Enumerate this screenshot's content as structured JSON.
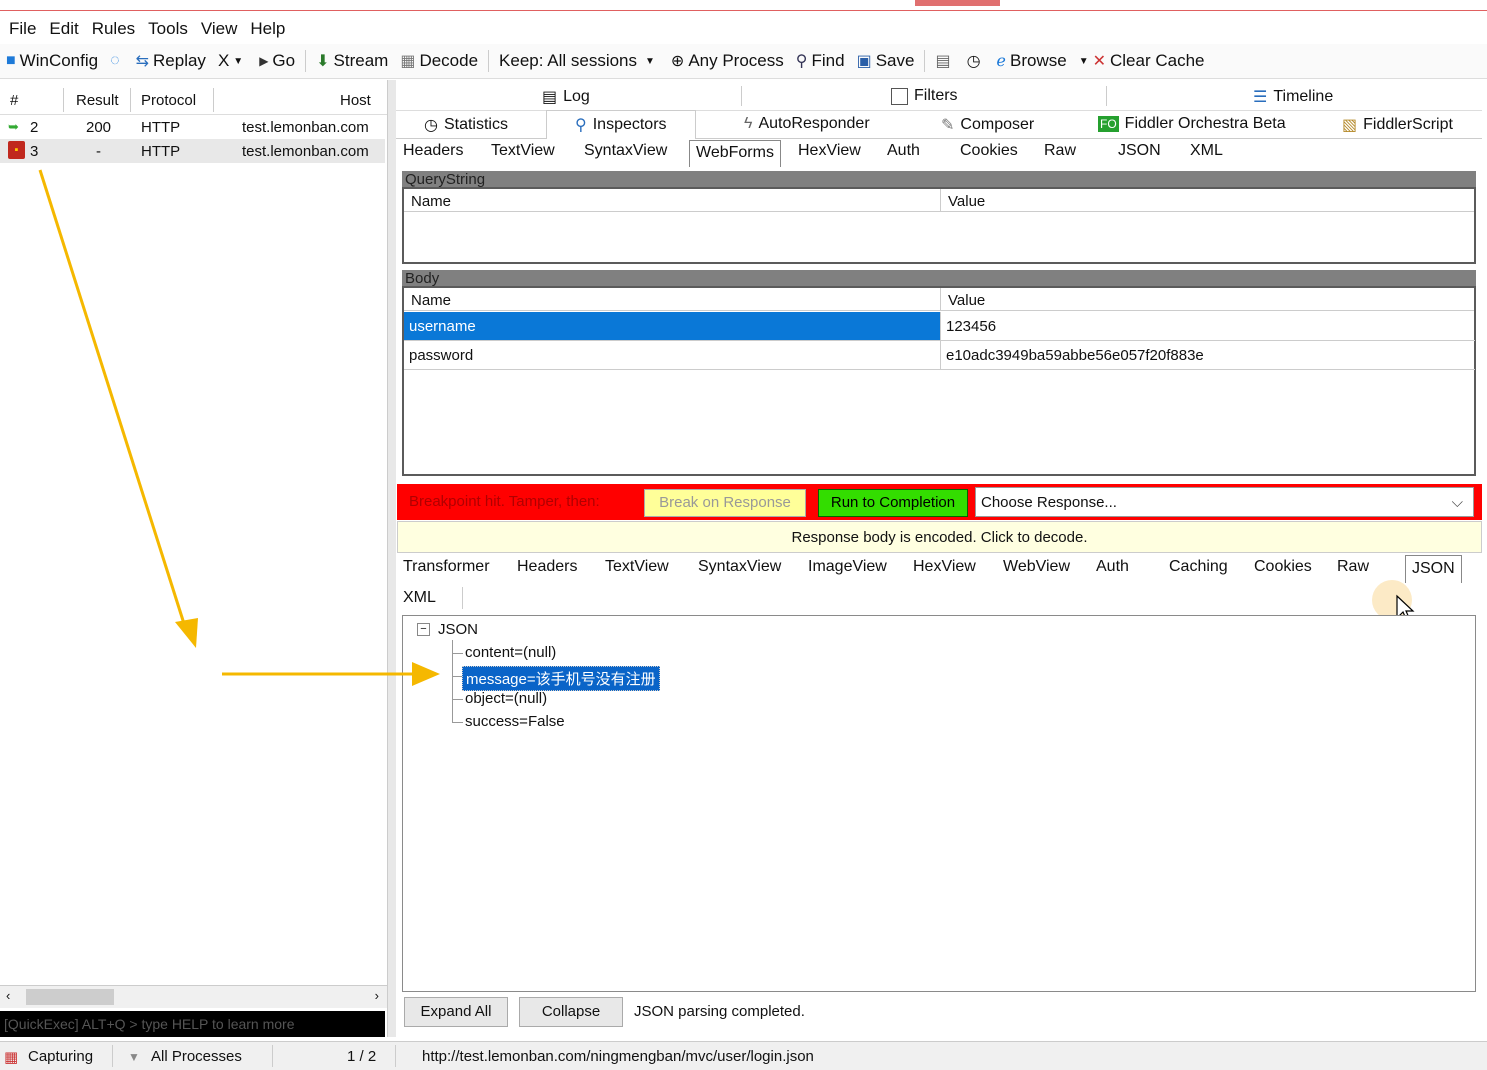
{
  "menu": [
    "File",
    "Edit",
    "Rules",
    "Tools",
    "View",
    "Help"
  ],
  "toolbar": {
    "winconfig": "WinConfig",
    "replay": "Replay",
    "remove": "X",
    "go": "Go",
    "stream": "Stream",
    "decode": "Decode",
    "keep": "Keep: All sessions",
    "process": "Any Process",
    "find": "Find",
    "save": "Save",
    "browse": "Browse",
    "clear_cache": "Clear Cache"
  },
  "sessions": {
    "headers": [
      "#",
      "Result",
      "Protocol",
      "Host"
    ],
    "rows": [
      {
        "id": "2",
        "result": "200",
        "protocol": "HTTP",
        "host": "test.lemonban.com"
      },
      {
        "id": "3",
        "result": "-",
        "protocol": "HTTP",
        "host": "test.lemonban.com"
      }
    ],
    "quickexec": "[QuickExec] ALT+Q > type HELP to learn more"
  },
  "top_tabs": {
    "log": "Log",
    "filters": "Filters",
    "timeline": "Timeline",
    "statistics": "Statistics",
    "inspectors": "Inspectors",
    "autoresponder": "AutoResponder",
    "composer": "Composer",
    "orchestra": "Fiddler Orchestra Beta",
    "orchestra_badge": "FO",
    "fiddlerscript": "FiddlerScript"
  },
  "request_tabs": [
    "Headers",
    "TextView",
    "SyntaxView",
    "WebForms",
    "HexView",
    "Auth",
    "Cookies",
    "Raw",
    "JSON",
    "XML"
  ],
  "querystring": {
    "title": "QueryString",
    "col_name": "Name",
    "col_value": "Value"
  },
  "body": {
    "title": "Body",
    "col_name": "Name",
    "col_value": "Value",
    "rows": [
      {
        "name": "username",
        "value": "123456"
      },
      {
        "name": "password",
        "value": "e10adc3949ba59abbe56e057f20f883e"
      }
    ]
  },
  "breakpoint": {
    "text": "Breakpoint hit. Tamper, then:",
    "break_on_response": "Break on Response",
    "run_to_completion": "Run to Completion",
    "choose_response": "Choose Response...",
    "encoded_notice": "Response body is encoded. Click to decode."
  },
  "response_tabs": [
    "Transformer",
    "Headers",
    "TextView",
    "SyntaxView",
    "ImageView",
    "HexView",
    "WebView",
    "Auth",
    "Caching",
    "Cookies",
    "Raw",
    "JSON"
  ],
  "response_tabs_row2": [
    "XML"
  ],
  "json_tree": {
    "root": "JSON",
    "children": [
      "content=(null)",
      "message=该手机号没有注册",
      "object=(null)",
      "success=False"
    ]
  },
  "json_buttons": {
    "expand_all": "Expand All",
    "collapse": "Collapse",
    "status": "JSON parsing completed."
  },
  "statusbar": {
    "capturing": "Capturing",
    "processes": "All Processes",
    "count": "1 / 2",
    "url": "http://test.lemonban.com/ningmengban/mvc/user/login.json"
  },
  "colors": {
    "breakpoint_red": "#ff0000",
    "run_green": "#33dd00",
    "break_yellow": "#ffff99",
    "selection_blue": "#0a64c8",
    "annotation_arrow": "#f5b800"
  }
}
